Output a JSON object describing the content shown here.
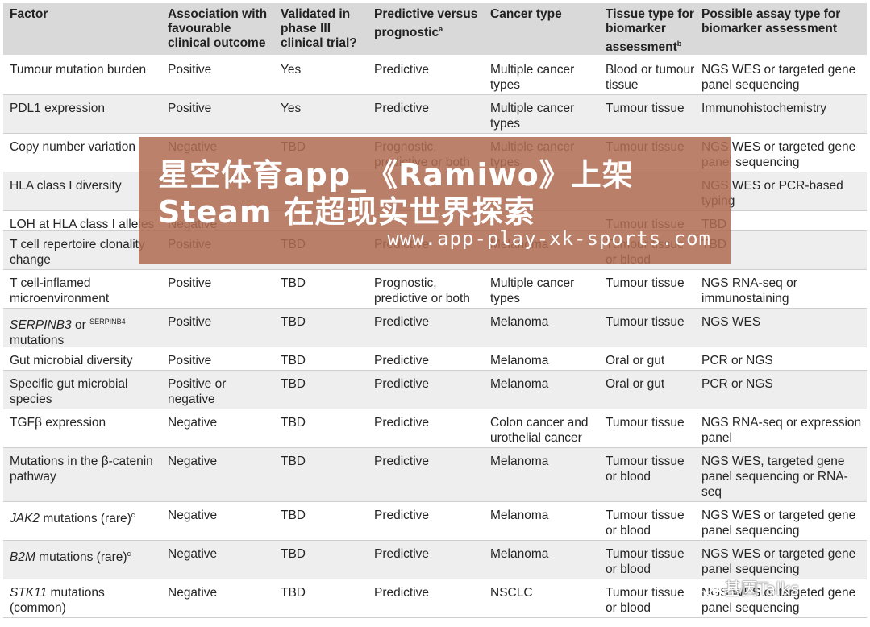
{
  "table": {
    "headers": [
      "Factor",
      "Association with favourable clinical outcome",
      "Validated in phase III clinical trial?",
      "Predictive versus prognostic",
      "Cancer type",
      "Tissue type for biomarker assessment",
      "Possible assay type for biomarker assessment"
    ],
    "header_sups": {
      "predictive": "a",
      "tissue": "b"
    },
    "rows": [
      {
        "factor": "Tumour mutation burden",
        "assoc": "Positive",
        "validated": "Yes",
        "pred": "Predictive",
        "cancer": "Multiple cancer types",
        "tissue": "Blood or tumour tissue",
        "assay": "NGS WES or targeted gene panel sequencing"
      },
      {
        "factor": "PDL1 expression",
        "assoc": "Positive",
        "validated": "Yes",
        "pred": "Predictive",
        "cancer": "Multiple cancer types",
        "tissue": "Tumour tissue",
        "assay": "Immunohistochemistry"
      },
      {
        "factor": "Copy number variation",
        "assoc": "Negative",
        "validated": "TBD",
        "pred": "Prognostic, predictive or both",
        "cancer": "Multiple cancer types",
        "tissue": "Tumour tissue",
        "assay": "NGS WES or targeted gene panel sequencing"
      },
      {
        "factor": "HLA class I diversity",
        "assoc": "",
        "validated": "",
        "pred": "",
        "cancer": "",
        "tissue": "",
        "assay": "NGS WES or PCR-based typing"
      },
      {
        "factor": "LOH at HLA class I alleles",
        "assoc": "Negative",
        "validated": "",
        "pred": "",
        "cancer": "",
        "tissue": "Tumour tissue",
        "assay": "TBD"
      },
      {
        "factor": "T cell repertoire clonality change",
        "assoc": "Positive",
        "validated": "TBD",
        "pred": "Predictive",
        "cancer": "Melanoma",
        "tissue": "Tumour tissue or blood",
        "assay": "TBD"
      },
      {
        "factor": "T cell-inflamed microenvironment",
        "assoc": "Positive",
        "validated": "TBD",
        "pred": "Prognostic, predictive or both",
        "cancer": "Multiple cancer types",
        "tissue": "Tumour tissue",
        "assay": "NGS RNA-seq or immunostaining"
      },
      {
        "factor": "SERPINB3 or SERPINB4 mutations",
        "factor_parts": [
          "SERPINB3",
          " or ",
          "SERPINB4",
          " mutations"
        ],
        "assoc": "Positive",
        "validated": "TBD",
        "pred": "Predictive",
        "cancer": "Melanoma",
        "tissue": "Tumour tissue",
        "assay": "NGS WES"
      },
      {
        "factor": "Gut microbial diversity",
        "assoc": "Positive",
        "validated": "TBD",
        "pred": "Predictive",
        "cancer": "Melanoma",
        "tissue": "Oral or gut",
        "assay": "PCR or NGS"
      },
      {
        "factor": "Specific gut microbial species",
        "assoc": "Positive or negative",
        "validated": "TBD",
        "pred": "Predictive",
        "cancer": "Melanoma",
        "tissue": "Oral or gut",
        "assay": "PCR or NGS"
      },
      {
        "factor": "TGFβ expression",
        "assoc": "Negative",
        "validated": "TBD",
        "pred": "Predictive",
        "cancer": "Colon cancer and urothelial cancer",
        "tissue": "Tumour tissue",
        "assay": "NGS RNA-seq or expression panel"
      },
      {
        "factor": "Mutations in the β-catenin pathway",
        "assoc": "Negative",
        "validated": "TBD",
        "pred": "Predictive",
        "cancer": "Melanoma",
        "tissue": "Tumour tissue or blood",
        "assay": "NGS WES, targeted gene panel sequencing or RNA-seq"
      },
      {
        "factor": "JAK2 mutations (rare)",
        "factor_parts": [
          "JAK2",
          " mutations (rare)",
          "c"
        ],
        "assoc": "Negative",
        "validated": "TBD",
        "pred": "Predictive",
        "cancer": "Melanoma",
        "tissue": "Tumour tissue or blood",
        "assay": "NGS WES or targeted gene panel sequencing"
      },
      {
        "factor": "B2M mutations (rare)",
        "factor_parts": [
          "B2M",
          " mutations (rare)",
          "c"
        ],
        "assoc": "Negative",
        "validated": "TBD",
        "pred": "Predictive",
        "cancer": "Melanoma",
        "tissue": "Tumour tissue or blood",
        "assay": "NGS WES or targeted gene panel sequencing"
      },
      {
        "factor": "STK11 mutations (common)",
        "factor_parts": [
          "STK11",
          " mutations (common)"
        ],
        "assoc": "Negative",
        "validated": "TBD",
        "pred": "Predictive",
        "cancer": "NSCLC",
        "tissue": "Tumour tissue or blood",
        "assay": "NGS WES or targeted gene panel sequencing"
      }
    ]
  },
  "overlay": {
    "title": "星空体育app_《Ramiwo》上架Steam 在超现实世界探索",
    "url": "www.app-play-xk-sports.com"
  },
  "watermark": {
    "text": "基因Talks",
    "icon": "wechat-icon"
  },
  "colors": {
    "header_bg": "#d9d9d9",
    "shade_row": "#eeeeee",
    "overlay_bg": "#b06c52"
  }
}
